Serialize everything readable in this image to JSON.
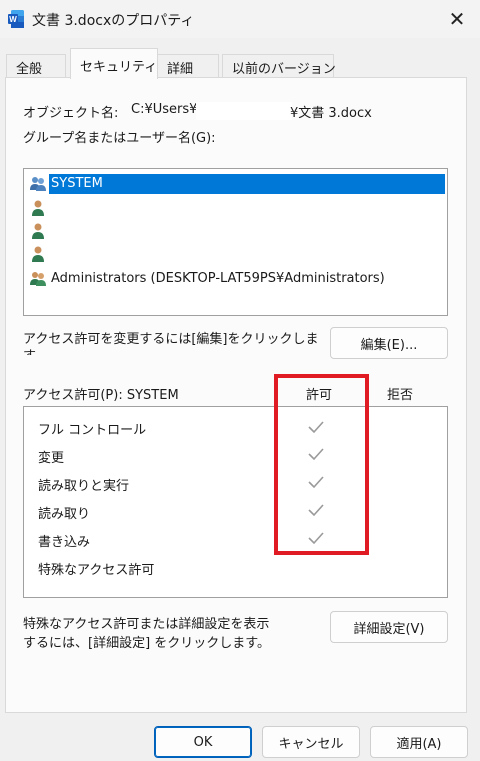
{
  "window": {
    "title": "文書 3.docxのプロパティ",
    "close_icon": "close-icon"
  },
  "tabs": [
    {
      "label": "全般"
    },
    {
      "label": "セキュリティ",
      "active": true
    },
    {
      "label": "詳細"
    },
    {
      "label": "以前のバージョン"
    }
  ],
  "object": {
    "label": "オブジェクト名:",
    "path_start": "C:¥Users¥",
    "path_end": "¥文書 3.docx"
  },
  "groups": {
    "label": "グループ名またはユーザー名(G):",
    "items": [
      {
        "name": "SYSTEM",
        "icon": "group-users-icon",
        "selected": true
      },
      {
        "name": "",
        "icon": "user-icon"
      },
      {
        "name": "",
        "icon": "user-icon"
      },
      {
        "name": "",
        "icon": "user-icon"
      },
      {
        "name": "Administrators (DESKTOP-LAT59PS¥Administrators)",
        "icon": "admin-group-icon"
      }
    ]
  },
  "change_permission": {
    "text_line1": "アクセス許可を変更するには[編集]をクリックしま",
    "text_line2": "す",
    "button": "編集(E)..."
  },
  "permissions": {
    "header": "アクセス許可(P): SYSTEM",
    "allow_header": "許可",
    "deny_header": "拒否",
    "items": [
      {
        "name": "フル コントロール",
        "allow": true,
        "deny": false
      },
      {
        "name": "変更",
        "allow": true,
        "deny": false
      },
      {
        "name": "読み取りと実行",
        "allow": true,
        "deny": false
      },
      {
        "name": "読み取り",
        "allow": true,
        "deny": false
      },
      {
        "name": "書き込み",
        "allow": true,
        "deny": false
      },
      {
        "name": "特殊なアクセス許可",
        "allow": false,
        "deny": false
      }
    ]
  },
  "advanced": {
    "text_line1": "特殊なアクセス許可または詳細設定を表示",
    "text_line2": "するには、[詳細設定] をクリックします。",
    "button": "詳細設定(V)"
  },
  "footer": {
    "ok": "OK",
    "cancel": "キャンセル",
    "apply": "適用(A)"
  },
  "colors": {
    "selection": "#0078d7",
    "highlight_box": "#e01b24",
    "check": "#9a9a9a",
    "word_blue": "#185abd"
  }
}
